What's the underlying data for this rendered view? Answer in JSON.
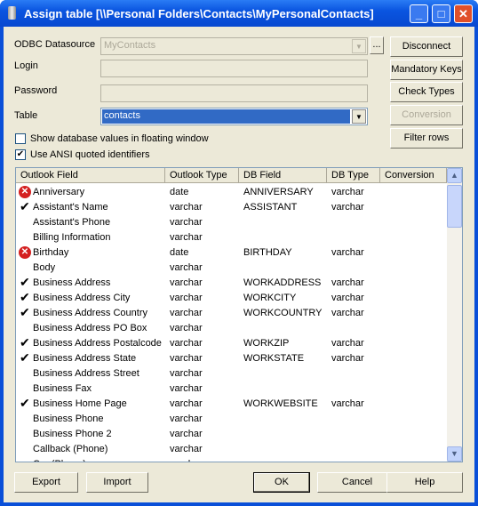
{
  "window": {
    "title": "Assign table [\\\\Personal Folders\\Contacts\\MyPersonalContacts]",
    "minimize": "_",
    "maximize": "□",
    "close": "✕"
  },
  "form": {
    "odbc_label": "ODBC Datasource",
    "odbc_value": "MyContacts",
    "browse": "...",
    "login_label": "Login",
    "login_value": "",
    "password_label": "Password",
    "password_value": "",
    "table_label": "Table",
    "table_value": "contacts",
    "show_floating": {
      "label": "Show database values in floating window",
      "checked": false
    },
    "ansi": {
      "label": "Use ANSI quoted identifiers",
      "checked": true,
      "mark": "✔"
    }
  },
  "side_buttons": {
    "disconnect": "Disconnect",
    "mandatory": "Mandatory Keys",
    "check_types": "Check Types",
    "conversion": "Conversion",
    "filter": "Filter rows"
  },
  "table": {
    "columns": [
      "Outlook Field",
      "Outlook Type",
      "DB Field",
      "DB Type",
      "Conversion"
    ],
    "rows": [
      {
        "status": "error",
        "field": "Anniversary",
        "type": "date",
        "db_field": "ANNIVERSARY",
        "db_type": "varchar",
        "conversion": ""
      },
      {
        "status": "ok",
        "field": "Assistant's Name",
        "type": "varchar",
        "db_field": "ASSISTANT",
        "db_type": "varchar",
        "conversion": ""
      },
      {
        "status": "",
        "field": "Assistant's Phone",
        "type": "varchar",
        "db_field": "",
        "db_type": "",
        "conversion": ""
      },
      {
        "status": "",
        "field": "Billing Information",
        "type": "varchar",
        "db_field": "",
        "db_type": "",
        "conversion": ""
      },
      {
        "status": "error",
        "field": "Birthday",
        "type": "date",
        "db_field": "BIRTHDAY",
        "db_type": "varchar",
        "conversion": ""
      },
      {
        "status": "",
        "field": "Body",
        "type": "varchar",
        "db_field": "",
        "db_type": "",
        "conversion": ""
      },
      {
        "status": "ok",
        "field": "Business Address",
        "type": "varchar",
        "db_field": "WORKADDRESS",
        "db_type": "varchar",
        "conversion": ""
      },
      {
        "status": "ok",
        "field": "Business Address City",
        "type": "varchar",
        "db_field": "WORKCITY",
        "db_type": "varchar",
        "conversion": ""
      },
      {
        "status": "ok",
        "field": "Business Address Country",
        "type": "varchar",
        "db_field": "WORKCOUNTRY",
        "db_type": "varchar",
        "conversion": ""
      },
      {
        "status": "",
        "field": "Business Address PO Box",
        "type": "varchar",
        "db_field": "",
        "db_type": "",
        "conversion": ""
      },
      {
        "status": "ok",
        "field": "Business Address Postalcode",
        "type": "varchar",
        "db_field": "WORKZIP",
        "db_type": "varchar",
        "conversion": ""
      },
      {
        "status": "ok",
        "field": "Business Address State",
        "type": "varchar",
        "db_field": "WORKSTATE",
        "db_type": "varchar",
        "conversion": ""
      },
      {
        "status": "",
        "field": "Business Address Street",
        "type": "varchar",
        "db_field": "",
        "db_type": "",
        "conversion": ""
      },
      {
        "status": "",
        "field": "Business Fax",
        "type": "varchar",
        "db_field": "",
        "db_type": "",
        "conversion": ""
      },
      {
        "status": "ok",
        "field": "Business Home Page",
        "type": "varchar",
        "db_field": "WORKWEBSITE",
        "db_type": "varchar",
        "conversion": ""
      },
      {
        "status": "",
        "field": "Business Phone",
        "type": "varchar",
        "db_field": "",
        "db_type": "",
        "conversion": ""
      },
      {
        "status": "",
        "field": "Business Phone 2",
        "type": "varchar",
        "db_field": "",
        "db_type": "",
        "conversion": ""
      },
      {
        "status": "",
        "field": "Callback (Phone)",
        "type": "varchar",
        "db_field": "",
        "db_type": "",
        "conversion": ""
      },
      {
        "status": "",
        "field": "Car (Phone)",
        "type": "varchar",
        "db_field": "",
        "db_type": "",
        "conversion": ""
      }
    ]
  },
  "bottom_buttons": {
    "export": "Export",
    "import": "Import",
    "ok": "OK",
    "cancel": "Cancel",
    "help": "Help"
  }
}
